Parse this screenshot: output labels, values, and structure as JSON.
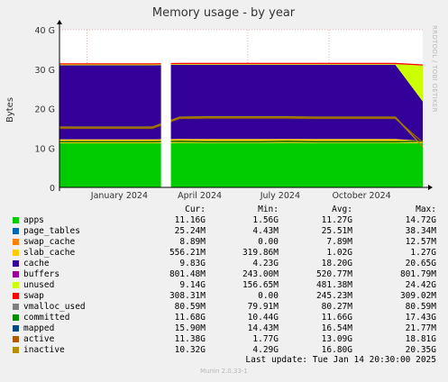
{
  "title": "Memory usage - by year",
  "ylabel": "Bytes",
  "side_label": "RRDTOOL / TOBI OETIKER",
  "footer_label": "Munin 2.0.33-1",
  "last_update": "Last update:  Tue Jan 14 20:30:00 2025",
  "headers": {
    "cur": "Cur:",
    "min": "Min:",
    "avg": "Avg:",
    "max": "Max:"
  },
  "chart_data": {
    "type": "area",
    "title": "Memory usage - by year",
    "ylabel": "Bytes",
    "ylim": [
      0,
      40
    ],
    "yunit": "G",
    "yticks": [
      "0",
      "10 G",
      "20 G",
      "30 G",
      "40 G"
    ],
    "xticks": [
      "January 2024",
      "April 2024",
      "July 2024",
      "October 2024"
    ],
    "grid": true,
    "x": [
      "2024-01",
      "2024-02",
      "2024-03",
      "2024-04",
      "2024-05",
      "2024-06",
      "2024-07",
      "2024-08",
      "2024-09",
      "2024-10",
      "2024-11",
      "2024-12",
      "2025-01"
    ],
    "stacked_series": [
      {
        "name": "apps",
        "color": "#00cc00",
        "values": [
          11.2,
          11.2,
          11.2,
          11.3,
          11.3,
          11.3,
          11.3,
          11.3,
          11.3,
          11.3,
          11.3,
          11.3,
          11.2
        ]
      },
      {
        "name": "slab_cache",
        "color": "#ffcc00",
        "values": [
          1.0,
          1.0,
          1.0,
          1.0,
          1.0,
          1.0,
          1.0,
          1.0,
          1.0,
          1.0,
          1.0,
          1.0,
          0.6
        ]
      },
      {
        "name": "cache",
        "color": "#330099",
        "values": [
          18.8,
          18.8,
          18.8,
          18.8,
          18.8,
          18.8,
          18.8,
          18.8,
          18.8,
          18.8,
          18.8,
          18.8,
          10.0
        ]
      },
      {
        "name": "unused",
        "color": "#ccff00",
        "values": [
          0.2,
          0.2,
          0.2,
          0.2,
          0.2,
          0.2,
          0.2,
          0.2,
          0.2,
          0.2,
          0.2,
          0.2,
          9.1
        ]
      },
      {
        "name": "swap",
        "color": "#ff0000",
        "values": [
          0.3,
          0.3,
          0.3,
          0.3,
          0.3,
          0.3,
          0.3,
          0.3,
          0.3,
          0.3,
          0.3,
          0.3,
          0.3
        ]
      }
    ],
    "line_series": [
      {
        "name": "committed",
        "color": "#006600",
        "values": [
          11.6,
          11.6,
          11.6,
          11.7,
          11.6,
          11.6,
          11.6,
          11.7,
          11.6,
          11.6,
          11.6,
          11.6,
          11.7
        ]
      },
      {
        "name": "active",
        "color": "#9b6000",
        "values": [
          15.0,
          15.0,
          15.0,
          17.5,
          17.6,
          17.6,
          17.6,
          17.6,
          17.5,
          17.5,
          17.5,
          17.5,
          11.4
        ]
      },
      {
        "name": "inactive",
        "color": "#aa8800",
        "values": [
          15.3,
          15.3,
          15.3,
          17.8,
          17.9,
          17.9,
          17.9,
          17.9,
          17.8,
          17.8,
          17.8,
          17.8,
          10.3
        ]
      }
    ],
    "gaps": [
      [
        "2024-03-25",
        "2024-04-05"
      ]
    ],
    "legend": [
      {
        "name": "apps",
        "color": "#00cc00",
        "cur": "11.16G",
        "min": "1.56G",
        "avg": "11.27G",
        "max": "14.72G"
      },
      {
        "name": "page_tables",
        "color": "#0066b3",
        "cur": "25.24M",
        "min": "4.43M",
        "avg": "25.51M",
        "max": "38.34M"
      },
      {
        "name": "swap_cache",
        "color": "#ff8000",
        "cur": "8.89M",
        "min": "0.00",
        "avg": "7.89M",
        "max": "12.57M"
      },
      {
        "name": "slab_cache",
        "color": "#ffcc00",
        "cur": "556.21M",
        "min": "319.86M",
        "avg": "1.02G",
        "max": "1.27G"
      },
      {
        "name": "cache",
        "color": "#330099",
        "cur": "9.83G",
        "min": "4.23G",
        "avg": "18.20G",
        "max": "20.65G"
      },
      {
        "name": "buffers",
        "color": "#990099",
        "cur": "801.48M",
        "min": "243.00M",
        "avg": "520.77M",
        "max": "801.79M"
      },
      {
        "name": "unused",
        "color": "#ccff00",
        "cur": "9.14G",
        "min": "156.65M",
        "avg": "481.38M",
        "max": "24.42G"
      },
      {
        "name": "swap",
        "color": "#ff0000",
        "cur": "308.31M",
        "min": "0.00",
        "avg": "245.23M",
        "max": "309.02M"
      },
      {
        "name": "vmalloc_used",
        "color": "#808080",
        "cur": "80.59M",
        "min": "79.91M",
        "avg": "80.27M",
        "max": "80.59M"
      },
      {
        "name": "committed",
        "color": "#008f00",
        "cur": "11.68G",
        "min": "10.44G",
        "avg": "11.66G",
        "max": "17.43G"
      },
      {
        "name": "mapped",
        "color": "#00487d",
        "cur": "15.90M",
        "min": "14.43M",
        "avg": "16.54M",
        "max": "21.77M"
      },
      {
        "name": "active",
        "color": "#b35a00",
        "cur": "11.38G",
        "min": "1.77G",
        "avg": "13.09G",
        "max": "18.81G"
      },
      {
        "name": "inactive",
        "color": "#b38f00",
        "cur": "10.32G",
        "min": "4.29G",
        "avg": "16.80G",
        "max": "20.35G"
      }
    ]
  }
}
